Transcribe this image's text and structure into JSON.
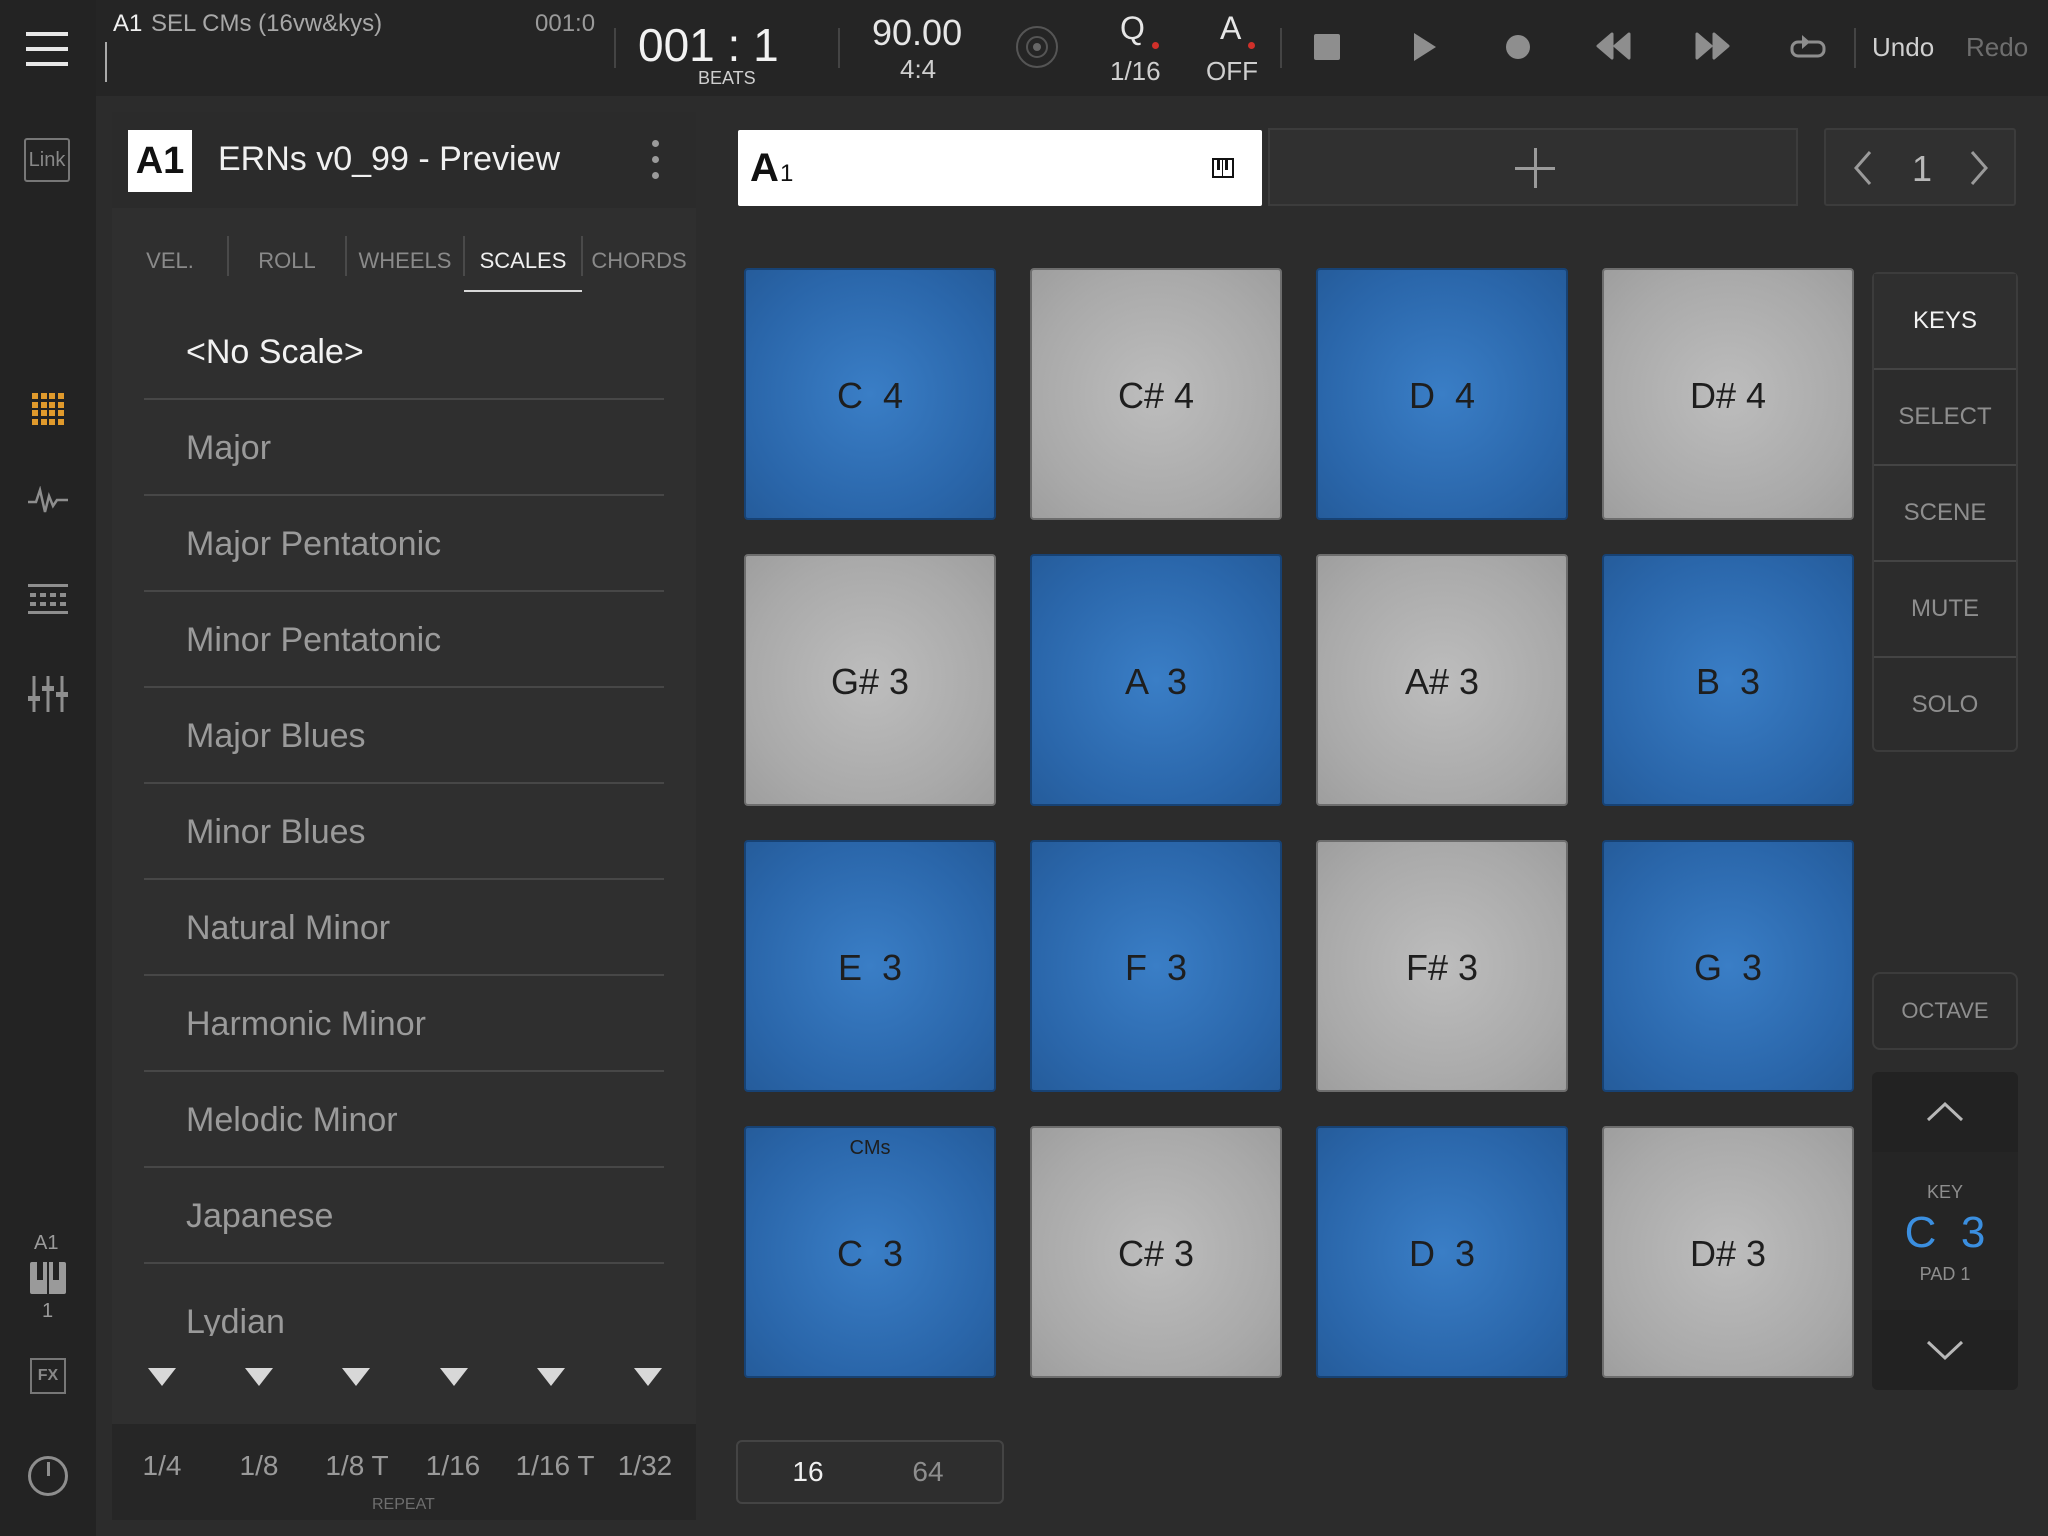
{
  "topbar": {
    "track_id": "A1",
    "track_name": "SEL CMs (16vw&kys)",
    "position_small": "001:0",
    "position": "001 : 1",
    "position_unit": "BEATS",
    "tempo": "90.00",
    "time_signature": "4:4",
    "quantize_label": "Q",
    "quantize_value": "1/16",
    "auto_label": "A",
    "auto_value": "OFF",
    "undo": "Undo",
    "redo": "Redo"
  },
  "leftbar": {
    "link_label": "Link",
    "track_label": "A1",
    "track_num": "1",
    "fx_label": "FX"
  },
  "panel": {
    "track_badge": "A1",
    "title": "ERNs v0_99 - Preview",
    "tabs": [
      "VEL.",
      "ROLL",
      "WHEELS",
      "SCALES",
      "CHORDS"
    ],
    "active_tab": "SCALES",
    "scales": [
      "<No Scale>",
      "Major",
      "Major Pentatonic",
      "Minor Pentatonic",
      "Major Blues",
      "Minor Blues",
      "Natural Minor",
      "Harmonic Minor",
      "Melodic Minor",
      "Japanese",
      "Lydian"
    ],
    "selected_scale": "<No Scale>",
    "repeat_values": [
      "1/4",
      "1/8",
      "1/8 T",
      "1/16",
      "1/16 T",
      "1/32"
    ],
    "repeat_label": "REPEAT"
  },
  "pattern": {
    "name_main": "A",
    "name_sub": "1",
    "page": "1"
  },
  "pads": [
    {
      "label": "C  4",
      "color": "blue"
    },
    {
      "label": "C# 4",
      "color": "gray"
    },
    {
      "label": "D  4",
      "color": "blue"
    },
    {
      "label": "D# 4",
      "color": "gray"
    },
    {
      "label": "G# 3",
      "color": "gray"
    },
    {
      "label": "A  3",
      "color": "blue"
    },
    {
      "label": "A# 3",
      "color": "gray"
    },
    {
      "label": "B  3",
      "color": "blue"
    },
    {
      "label": "E  3",
      "color": "blue"
    },
    {
      "label": "F  3",
      "color": "blue"
    },
    {
      "label": "F# 3",
      "color": "gray"
    },
    {
      "label": "G  3",
      "color": "blue"
    },
    {
      "label": "C  3",
      "color": "blue",
      "tag": "CMs"
    },
    {
      "label": "C# 3",
      "color": "gray"
    },
    {
      "label": "D  3",
      "color": "blue"
    },
    {
      "label": "D# 3",
      "color": "gray"
    }
  ],
  "modes": [
    "KEYS",
    "SELECT",
    "SCENE",
    "MUTE",
    "SOLO"
  ],
  "active_mode": "KEYS",
  "octave": {
    "label": "OCTAVE",
    "key_label": "KEY",
    "key_value": "C  3",
    "pad_label": "PAD 1"
  },
  "pad_count": {
    "options": [
      "16",
      "64"
    ],
    "active": "16"
  },
  "colors": {
    "accent_blue": "#2a66aa",
    "key_blue": "#3b8fe0",
    "accent_orange": "#e09a2c",
    "record_red": "#d0302a"
  }
}
